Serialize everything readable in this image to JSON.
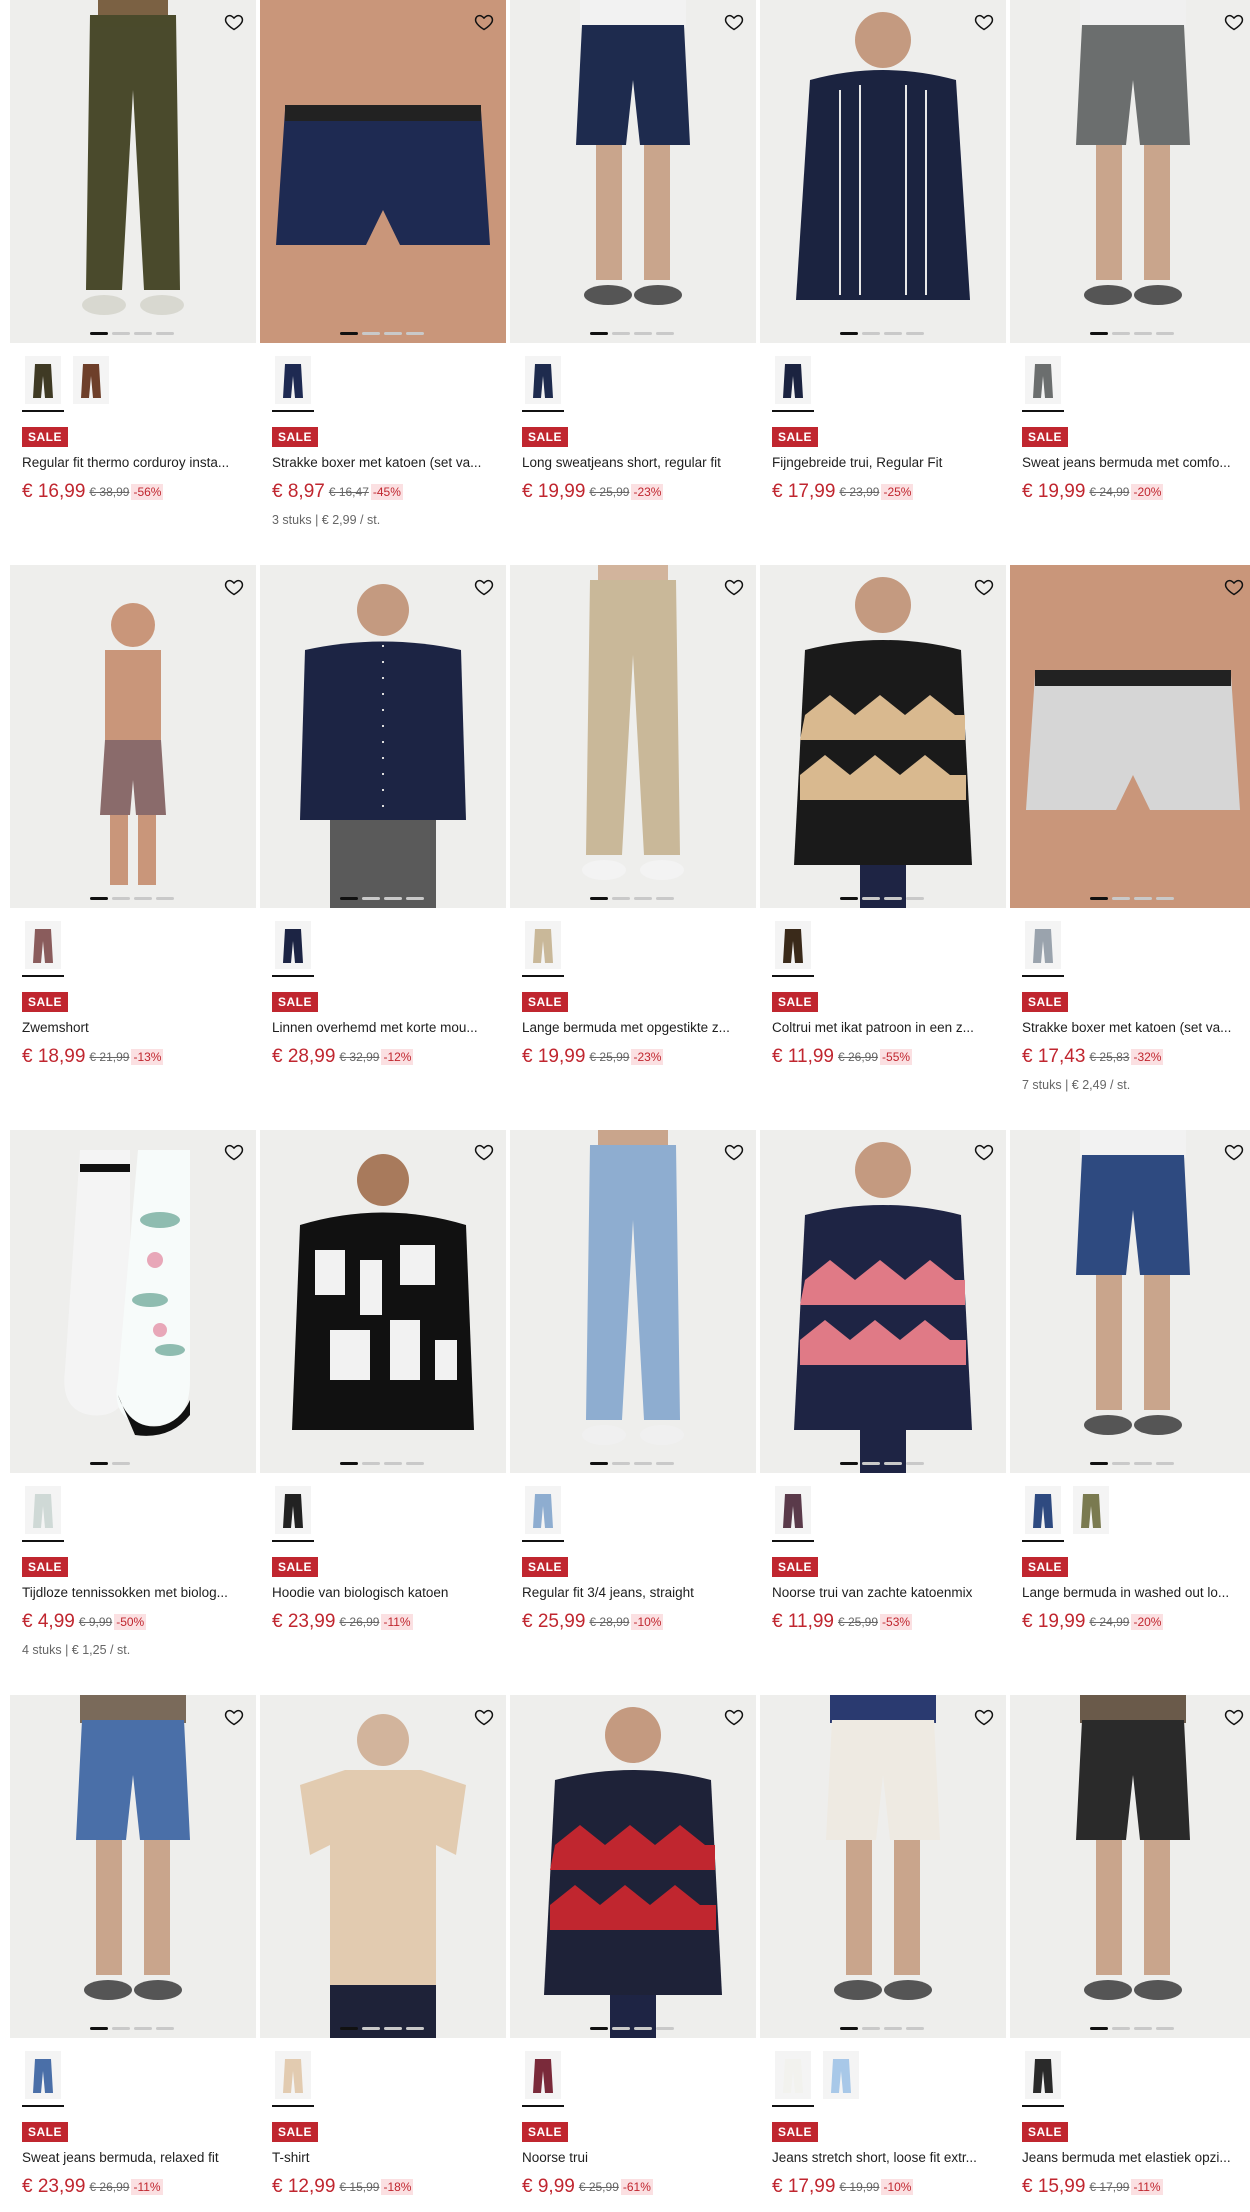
{
  "colors": {
    "accent": "#c0262f",
    "discount_bg": "#fbe0e2"
  },
  "wishlist_icon": "heart-outline-icon",
  "products": [
    {
      "title": "Regular fit thermo corduroy insta...",
      "badge": "SALE",
      "price": "€ 16,99",
      "old_price": "€ 38,99",
      "discount": "-56%",
      "unit": "",
      "dots": 4,
      "active_dot": 0,
      "swatches": 2,
      "selected_swatch": 0,
      "art": "pants",
      "colors": [
        "#4a4a2c",
        "#d8d8d0",
        "#7b6143"
      ],
      "swatch_colors": [
        "#3f3a24",
        "#6e3f2a"
      ]
    },
    {
      "title": "Strakke boxer met katoen (set va...",
      "badge": "SALE",
      "price": "€ 8,97",
      "old_price": "€ 16,47",
      "discount": "-45%",
      "unit": "3 stuks | € 2,99 / st.",
      "dots": 4,
      "active_dot": 0,
      "swatches": 1,
      "selected_swatch": 0,
      "art": "boxer",
      "colors": [
        "#1e2a52",
        "#c9967a",
        "#c9967a"
      ],
      "swatch_colors": [
        "#1e2a52"
      ]
    },
    {
      "title": "Long sweatjeans short, regular fit",
      "badge": "SALE",
      "price": "€ 19,99",
      "old_price": "€ 25,99",
      "discount": "-23%",
      "unit": "",
      "dots": 4,
      "active_dot": 0,
      "swatches": 1,
      "selected_swatch": 0,
      "art": "shorts",
      "colors": [
        "#1e2b4e",
        "#f2f2f2",
        "#c9a58c"
      ],
      "swatch_colors": [
        "#1e2b4e"
      ]
    },
    {
      "title": "Fijngebreide trui, Regular Fit",
      "badge": "SALE",
      "price": "€ 17,99",
      "old_price": "€ 23,99",
      "discount": "-25%",
      "unit": "",
      "dots": 4,
      "active_dot": 0,
      "swatches": 1,
      "selected_swatch": 0,
      "art": "sweater",
      "colors": [
        "#1b2340",
        "#1b2340",
        "#c49a80"
      ],
      "swatch_colors": [
        "#1b2340"
      ]
    },
    {
      "title": "Sweat jeans bermuda met comfo...",
      "badge": "SALE",
      "price": "€ 19,99",
      "old_price": "€ 24,99",
      "discount": "-20%",
      "unit": "",
      "dots": 4,
      "active_dot": 0,
      "swatches": 1,
      "selected_swatch": 0,
      "art": "shorts",
      "colors": [
        "#6b6e6e",
        "#f0f0f0",
        "#c9a58c"
      ],
      "swatch_colors": [
        "#6b6e6e"
      ]
    },
    {
      "title": "Zwemshort",
      "badge": "SALE",
      "price": "€ 18,99",
      "old_price": "€ 21,99",
      "discount": "-13%",
      "unit": "",
      "dots": 4,
      "active_dot": 0,
      "swatches": 1,
      "selected_swatch": 0,
      "art": "swimshort",
      "colors": [
        "#8a6b6b",
        "#c9967a",
        "#c9967a"
      ],
      "swatch_colors": [
        "#8a5c5c"
      ]
    },
    {
      "title": "Linnen overhemd met korte mou...",
      "badge": "SALE",
      "price": "€ 28,99",
      "old_price": "€ 32,99",
      "discount": "-12%",
      "unit": "",
      "dots": 4,
      "active_dot": 0,
      "swatches": 1,
      "selected_swatch": 0,
      "art": "shirt",
      "colors": [
        "#1c2444",
        "#5a5a5a",
        "#c49a80"
      ],
      "swatch_colors": [
        "#1c2444"
      ]
    },
    {
      "title": "Lange bermuda met opgestikte z...",
      "badge": "SALE",
      "price": "€ 19,99",
      "old_price": "€ 25,99",
      "discount": "-23%",
      "unit": "",
      "dots": 4,
      "active_dot": 0,
      "swatches": 1,
      "selected_swatch": 0,
      "art": "pants",
      "colors": [
        "#c9b899",
        "#f3f3f3",
        "#d2b49c"
      ],
      "swatch_colors": [
        "#c9b899"
      ]
    },
    {
      "title": "Coltrui met ikat patroon in een z...",
      "badge": "SALE",
      "price": "€ 11,99",
      "old_price": "€ 26,99",
      "discount": "-55%",
      "unit": "",
      "dots": 4,
      "active_dot": 0,
      "swatches": 1,
      "selected_swatch": 0,
      "art": "pattern-sweater",
      "colors": [
        "#1a1a1a",
        "#d9b98f",
        "#c49a80"
      ],
      "swatch_colors": [
        "#3a2a1a"
      ]
    },
    {
      "title": "Strakke boxer met katoen (set va...",
      "badge": "SALE",
      "price": "€ 17,43",
      "old_price": "€ 25,83",
      "discount": "-32%",
      "unit": "7 stuks | € 2,49 / st.",
      "dots": 4,
      "active_dot": 0,
      "swatches": 1,
      "selected_swatch": 0,
      "art": "boxer",
      "colors": [
        "#d6d6d6",
        "#c9967a",
        "#c9967a"
      ],
      "swatch_colors": [
        "#9aa3ad"
      ]
    },
    {
      "title": "Tijdloze tennissokken met biolog...",
      "badge": "SALE",
      "price": "€ 4,99",
      "old_price": "€ 9,99",
      "discount": "-50%",
      "unit": "4 stuks | € 1,25 / st.",
      "dots": 2,
      "active_dot": 0,
      "swatches": 1,
      "selected_swatch": 0,
      "art": "socks",
      "colors": [
        "#f4f4f4",
        "#8fbcb0",
        "#e8a7b8"
      ],
      "swatch_colors": [
        "#cfd9d6"
      ]
    },
    {
      "title": "Hoodie van biologisch katoen",
      "badge": "SALE",
      "price": "€ 23,99",
      "old_price": "€ 26,99",
      "discount": "-11%",
      "unit": "",
      "dots": 4,
      "active_dot": 0,
      "swatches": 1,
      "selected_swatch": 0,
      "art": "hoodie",
      "colors": [
        "#111111",
        "#f2f2f2",
        "#a87a5c"
      ],
      "swatch_colors": [
        "#222222"
      ]
    },
    {
      "title": "Regular fit 3/4 jeans, straight",
      "badge": "SALE",
      "price": "€ 25,99",
      "old_price": "€ 28,99",
      "discount": "-10%",
      "unit": "",
      "dots": 4,
      "active_dot": 0,
      "swatches": 1,
      "selected_swatch": 0,
      "art": "pants",
      "colors": [
        "#8eadd0",
        "#f0f0f0",
        "#c9a58c"
      ],
      "swatch_colors": [
        "#8eadd0"
      ]
    },
    {
      "title": "Noorse trui van zachte katoenmix",
      "badge": "SALE",
      "price": "€ 11,99",
      "old_price": "€ 25,99",
      "discount": "-53%",
      "unit": "",
      "dots": 4,
      "active_dot": 0,
      "swatches": 1,
      "selected_swatch": 0,
      "art": "pattern-sweater",
      "colors": [
        "#1e2444",
        "#e07a86",
        "#c49a80"
      ],
      "swatch_colors": [
        "#5a3a4a"
      ]
    },
    {
      "title": "Lange bermuda in washed out lo...",
      "badge": "SALE",
      "price": "€ 19,99",
      "old_price": "€ 24,99",
      "discount": "-20%",
      "unit": "",
      "dots": 4,
      "active_dot": 0,
      "swatches": 2,
      "selected_swatch": 0,
      "art": "shorts",
      "colors": [
        "#2e4a80",
        "#f2f2f2",
        "#c9a58c"
      ],
      "swatch_colors": [
        "#2e4a80",
        "#7a7a50"
      ]
    },
    {
      "title": "Sweat jeans bermuda, relaxed fit",
      "badge": "SALE",
      "price": "€ 23,99",
      "old_price": "€ 26,99",
      "discount": "-11%",
      "unit": "",
      "dots": 4,
      "active_dot": 0,
      "swatches": 1,
      "selected_swatch": 0,
      "art": "shorts",
      "colors": [
        "#4a6fa8",
        "#7a6a5a",
        "#c9a58c"
      ],
      "swatch_colors": [
        "#4a6fa8"
      ]
    },
    {
      "title": "T-shirt",
      "badge": "SALE",
      "price": "€ 12,99",
      "old_price": "€ 15,99",
      "discount": "-18%",
      "unit": "",
      "dots": 4,
      "active_dot": 0,
      "swatches": 1,
      "selected_swatch": 0,
      "art": "tshirt",
      "colors": [
        "#e2cbb0",
        "#1e2238",
        "#d2b49c"
      ],
      "swatch_colors": [
        "#e2cbb0"
      ]
    },
    {
      "title": "Noorse trui",
      "badge": "SALE",
      "price": "€ 9,99",
      "old_price": "€ 25,99",
      "discount": "-61%",
      "unit": "",
      "dots": 4,
      "active_dot": 0,
      "swatches": 1,
      "selected_swatch": 0,
      "art": "pattern-sweater",
      "colors": [
        "#1e2238",
        "#c0262f",
        "#c49a80"
      ],
      "swatch_colors": [
        "#7a2a3a"
      ]
    },
    {
      "title": "Jeans stretch short, loose fit extr...",
      "badge": "SALE",
      "price": "€ 17,99",
      "old_price": "€ 19,99",
      "discount": "-10%",
      "unit": "",
      "dots": 4,
      "active_dot": 0,
      "swatches": 2,
      "selected_swatch": 0,
      "art": "shorts",
      "colors": [
        "#eeeae2",
        "#2a3a70",
        "#c9a58c"
      ],
      "swatch_colors": [
        "#f2f2ee",
        "#a8c8e8"
      ]
    },
    {
      "title": "Jeans bermuda met elastiek opzi...",
      "badge": "SALE",
      "price": "€ 15,99",
      "old_price": "€ 17,99",
      "discount": "-11%",
      "unit": "",
      "dots": 4,
      "active_dot": 0,
      "swatches": 1,
      "selected_swatch": 0,
      "art": "shorts",
      "colors": [
        "#2a2a2a",
        "#6a5a4a",
        "#c9a58c"
      ],
      "swatch_colors": [
        "#2a2a2a"
      ]
    }
  ]
}
